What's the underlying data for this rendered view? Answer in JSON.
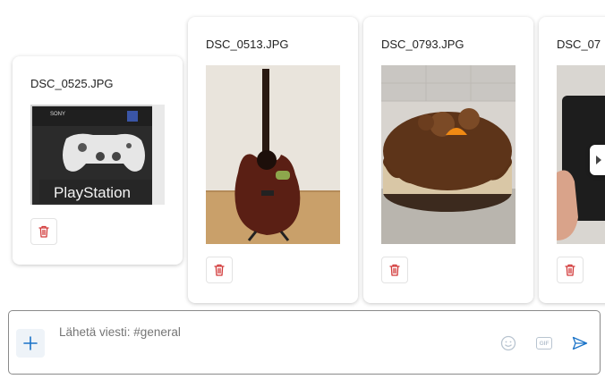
{
  "gallery": {
    "items": [
      {
        "filename": "DSC_0525.JPG",
        "image": "playstation-controller-box-photo"
      },
      {
        "filename": "DSC_0513.JPG",
        "image": "acoustic-guitar-photo"
      },
      {
        "filename": "DSC_0793.JPG",
        "image": "chocolate-cake-photo"
      },
      {
        "filename": "DSC_07",
        "image": "black-device-in-hand-photo"
      }
    ],
    "box_text": {
      "brand": "SONY",
      "title": "PlayStation"
    }
  },
  "composer": {
    "placeholder": "Lähetä viesti: #general",
    "gif_label": "GIF"
  },
  "icons": {
    "delete": "trash-icon",
    "next": "chevron-right-icon",
    "add": "plus-icon",
    "emoji": "smiley-icon",
    "gif": "gif-icon",
    "send": "send-icon"
  },
  "colors": {
    "accent": "#1a73c8",
    "delete_red": "#d23a3a",
    "muted_icon": "#b8c4d0"
  }
}
